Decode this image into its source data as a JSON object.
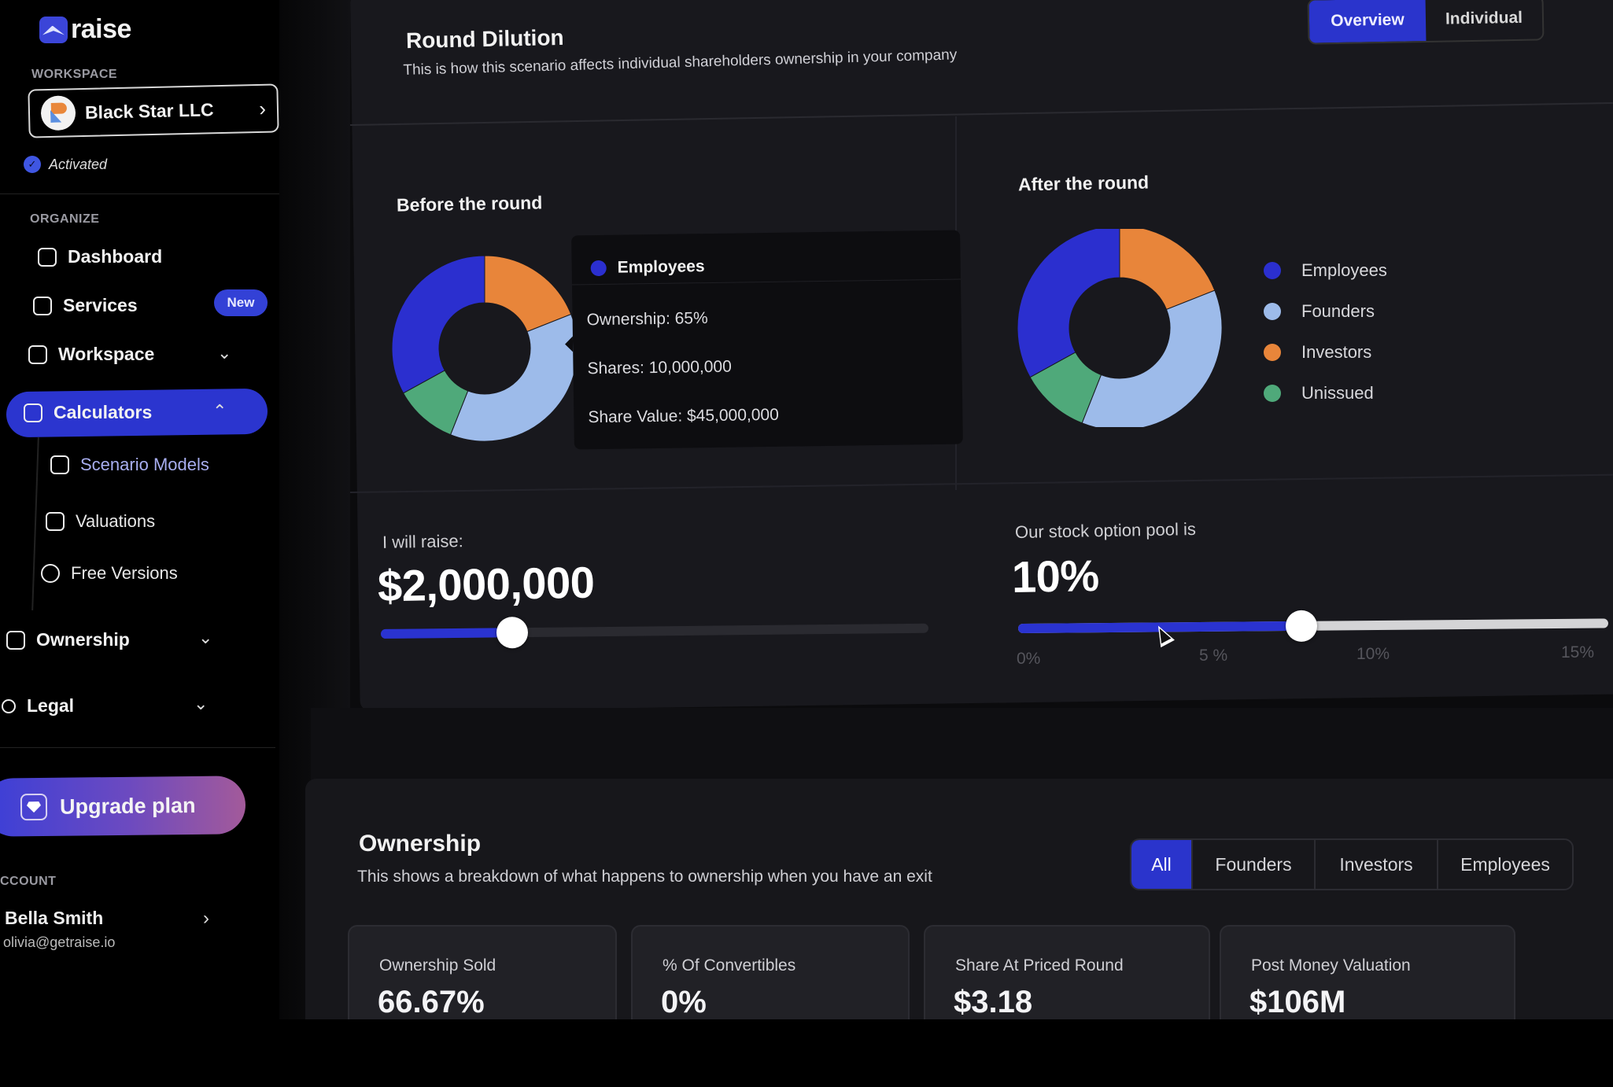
{
  "app": {
    "name": "raise"
  },
  "sidebar": {
    "workspace_label": "WORKSPACE",
    "workspace_name": "Black Star LLC",
    "workspace_status": "Activated",
    "organize_label": "ORGANIZE",
    "items": [
      {
        "label": "Dashboard",
        "icon": "dashboard-icon"
      },
      {
        "label": "Services",
        "icon": "briefcase-icon",
        "badge": "New"
      },
      {
        "label": "Workspace",
        "icon": "building-icon",
        "expandable": true
      },
      {
        "label": "Calculators",
        "icon": "calculator-icon",
        "expanded": true,
        "active": true
      },
      {
        "label": "Ownership",
        "icon": "grid-icon",
        "expandable": true
      },
      {
        "label": "Legal",
        "icon": "nodes-icon",
        "expandable": true
      }
    ],
    "calculators_sub": [
      {
        "label": "Scenario Models",
        "icon": "chart-icon",
        "active": true
      },
      {
        "label": "Valuations",
        "icon": "chart-icon"
      },
      {
        "label": "Free Versions",
        "icon": "globe-icon"
      }
    ],
    "upgrade_label": "Upgrade plan",
    "account_label": "CCOUNT",
    "account_name": "Bella Smith",
    "account_email": "olivia@getraise.io"
  },
  "round_dilution": {
    "title": "Round Dilution",
    "description": "This is how this scenario affects individual shareholders ownership in your company",
    "view_tabs": [
      {
        "label": "Overview",
        "active": true
      },
      {
        "label": "Individual",
        "active": false
      }
    ],
    "before_title": "Before the round",
    "after_title": "After the round",
    "tooltip": {
      "series": "Employees",
      "ownership": "Ownership: 65%",
      "shares": "Shares: 10,000,000",
      "share_value": "Share Value: $45,000,000"
    },
    "raise": {
      "label": "I will raise:",
      "value": "$2,000,000",
      "fill_fraction": 0.24
    },
    "option_pool": {
      "label": "Our stock option pool is",
      "value": "10%",
      "value_pct": 10,
      "min_pct": 0,
      "max_pct": 20,
      "ticks": [
        "0%",
        "5 %",
        "10%",
        "15%"
      ]
    }
  },
  "colors": {
    "accent": "#2a33d0",
    "employees": "#2b2fcf",
    "founders": "#9dbbea",
    "investors": "#e8853a",
    "unissued": "#4fa97a"
  },
  "chart_data": [
    {
      "type": "pie",
      "title": "Before the round",
      "donut": true,
      "categories": [
        "Investors",
        "Founders",
        "Unissued",
        "Employees"
      ],
      "values": [
        19,
        37,
        11,
        33
      ],
      "colors": [
        "#e8853a",
        "#9dbbea",
        "#4fa97a",
        "#2b2fcf"
      ]
    },
    {
      "type": "pie",
      "title": "After the round",
      "donut": true,
      "categories": [
        "Investors",
        "Founders",
        "Unissued",
        "Employees"
      ],
      "values": [
        19,
        37,
        11,
        33
      ],
      "colors": [
        "#e8853a",
        "#9dbbea",
        "#4fa97a",
        "#2b2fcf"
      ],
      "legend": [
        "Employees",
        "Founders",
        "Investors",
        "Unissued"
      ],
      "legend_position": "right"
    }
  ],
  "ownership": {
    "title": "Ownership",
    "description": "This shows a breakdown of what happens to ownership when you have an exit",
    "filters": [
      {
        "label": "All",
        "active": true
      },
      {
        "label": "Founders",
        "active": false
      },
      {
        "label": "Investors",
        "active": false
      },
      {
        "label": "Employees",
        "active": false
      }
    ],
    "stats": [
      {
        "label": "Ownership Sold",
        "value": "66.67%"
      },
      {
        "label": "% Of Convertibles",
        "value": "0%"
      },
      {
        "label": "Share At Priced Round",
        "value": "$3.18"
      },
      {
        "label": "Post Money Valuation",
        "value": "$106M"
      }
    ]
  }
}
